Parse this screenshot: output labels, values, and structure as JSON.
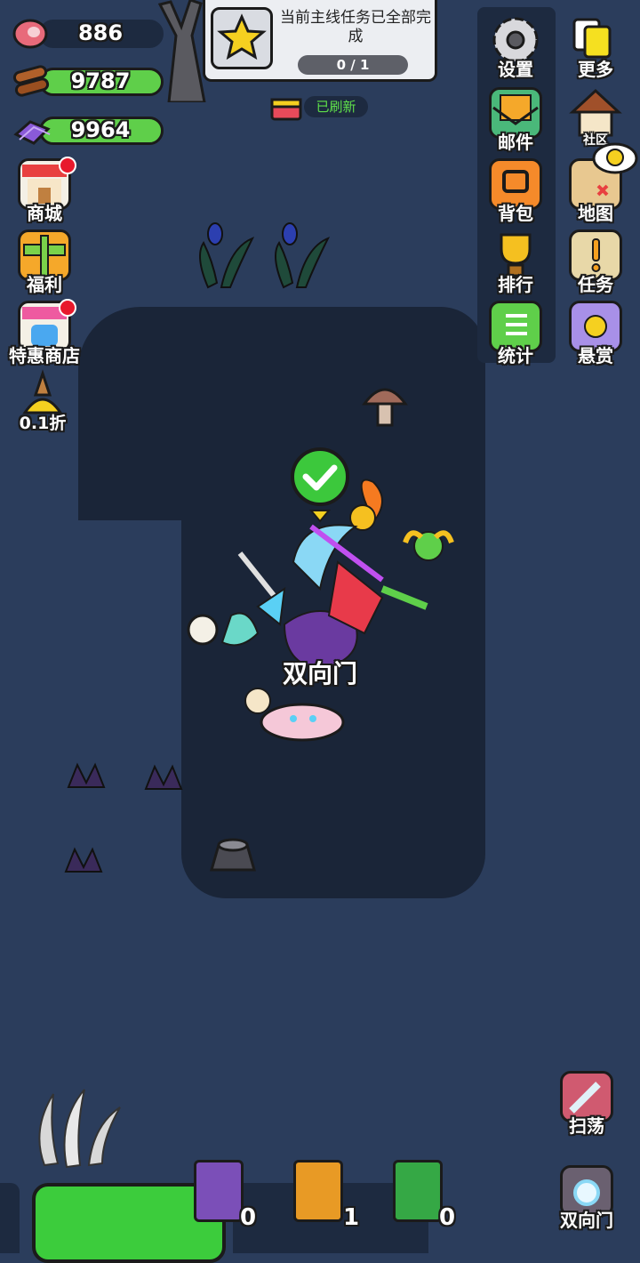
{
  "resources": [
    {
      "name": "meat",
      "value": "886",
      "bar_color": "#1d2a40"
    },
    {
      "name": "wood",
      "value": "9787",
      "bar_color": "#5fcf4a"
    },
    {
      "name": "crystal",
      "value": "9964",
      "bar_color": "#5fcf4a"
    }
  ],
  "quest": {
    "text": "当前主线任务已全部完成",
    "progress": "0 / 1",
    "refreshed": "已刷新"
  },
  "left_menu": [
    {
      "label": "商城",
      "icon": "shop-icon",
      "badge": true
    },
    {
      "label": "福利",
      "icon": "gift-icon",
      "badge": false
    },
    {
      "label": "特惠商店",
      "icon": "special-shop-icon",
      "badge": true
    },
    {
      "label": "0.1折",
      "icon": "discount-icon",
      "badge": false
    }
  ],
  "right_menu_col1": [
    {
      "label": "设置",
      "icon": "gear-icon"
    },
    {
      "label": "邮件",
      "icon": "mail-icon"
    },
    {
      "label": "背包",
      "icon": "backpack-icon"
    },
    {
      "label": "排行",
      "icon": "trophy-icon"
    },
    {
      "label": "统计",
      "icon": "stats-book-icon"
    }
  ],
  "right_menu_col2": [
    {
      "label": "更多",
      "icon": "cards-icon"
    },
    {
      "label": "社区",
      "icon": "house-icon"
    },
    {
      "label": "地图",
      "icon": "map-icon"
    },
    {
      "label": "任务",
      "icon": "scroll-icon"
    },
    {
      "label": "悬赏",
      "icon": "bounty-icon"
    }
  ],
  "player": {
    "name": "双向门"
  },
  "bottom": {
    "sweep_label": "扫荡",
    "portal_label": "双向门",
    "books": [
      {
        "name": "purple-book",
        "count": "0",
        "color": "#7b4fb8"
      },
      {
        "name": "orange-book",
        "count": "1",
        "color": "#e89a25"
      },
      {
        "name": "green-book",
        "count": "0",
        "color": "#35a845"
      }
    ]
  },
  "colors": {
    "background": "#2b3d5c",
    "path": "#1a2538",
    "panel": "#1d2a40",
    "accent_green": "#5fcf4a"
  }
}
